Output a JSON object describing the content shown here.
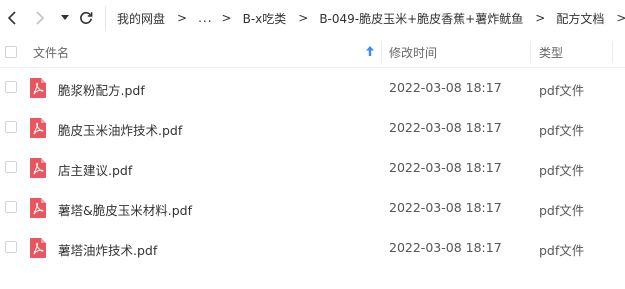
{
  "breadcrumb": {
    "items": [
      "我的网盘",
      "...",
      "B-x吃类",
      "B-049-脆皮玉米+脆皮香蕉+薯炸鱿鱼",
      "配方文档"
    ],
    "separator": ">"
  },
  "list_header": {
    "name": "文件名",
    "modified": "修改时间",
    "type": "类型"
  },
  "files": [
    {
      "name": "脆浆粉配方.pdf",
      "modified": "2022-03-08 18:17",
      "type": "pdf文件"
    },
    {
      "name": "脆皮玉米油炸技术.pdf",
      "modified": "2022-03-08 18:17",
      "type": "pdf文件"
    },
    {
      "name": "店主建议.pdf",
      "modified": "2022-03-08 18:17",
      "type": "pdf文件"
    },
    {
      "name": "薯塔&脆皮玉米材料.pdf",
      "modified": "2022-03-08 18:17",
      "type": "pdf文件"
    },
    {
      "name": "薯塔油炸技术.pdf",
      "modified": "2022-03-08 18:17",
      "type": "pdf文件"
    }
  ],
  "colors": {
    "pdf_icon": "#e8565f",
    "sort_arrow": "#3b8cf5"
  }
}
